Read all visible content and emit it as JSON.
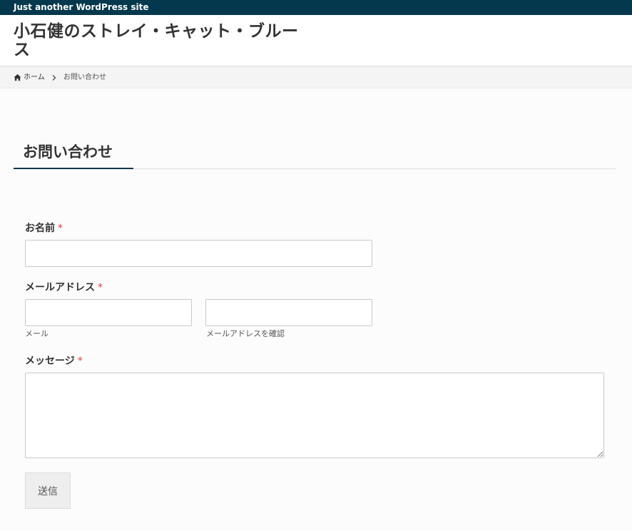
{
  "topbar": {
    "tagline": "Just another WordPress site"
  },
  "header": {
    "site_title": "小石健のストレイ・キャット・ブルース"
  },
  "breadcrumb": {
    "home_icon": "home-icon",
    "home_label": "ホーム",
    "separator_icon": "chevron-right-icon",
    "current": "お問い合わせ"
  },
  "page": {
    "title": "お問い合わせ"
  },
  "form": {
    "name_label": "お名前",
    "required_mark": "*",
    "email_label": "メールアドレス",
    "email_sub": "メール",
    "email_confirm_sub": "メールアドレスを確認",
    "message_label": "メッセージ",
    "submit_label": "送信"
  },
  "colors": {
    "accent": "#04384c",
    "required": "#e23d3d"
  }
}
